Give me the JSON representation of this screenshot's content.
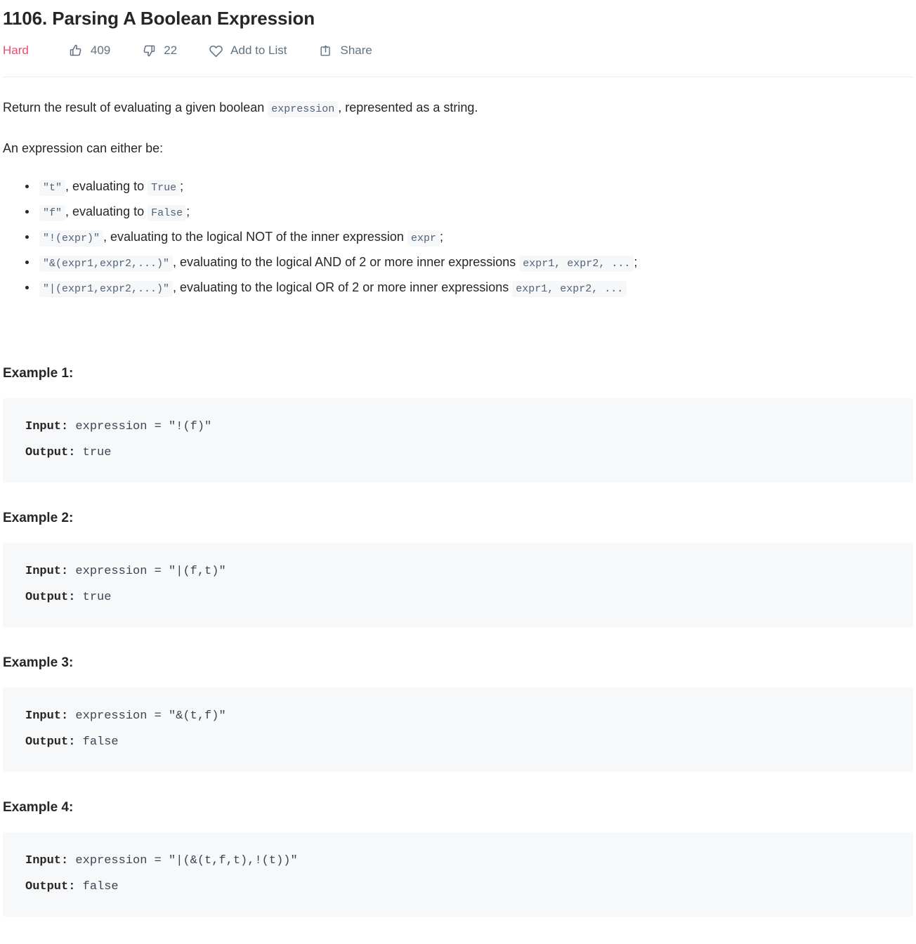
{
  "problem": {
    "title": "1106. Parsing A Boolean Expression",
    "difficulty": "Hard",
    "likes": "409",
    "dislikes": "22",
    "add_to_list_label": "Add to List",
    "share_label": "Share"
  },
  "description": {
    "intro_before": "Return the result of evaluating a given boolean ",
    "intro_code": "expression",
    "intro_after": ", represented as a string.",
    "lead": "An expression can either be:",
    "rules": [
      {
        "code": "\"t\"",
        "text_mid": ", evaluating to ",
        "code2": "True",
        "text_end": ";"
      },
      {
        "code": "\"f\"",
        "text_mid": ", evaluating to ",
        "code2": "False",
        "text_end": ";"
      },
      {
        "code": "\"!(expr)\"",
        "text_mid": ", evaluating to the logical NOT of the inner expression ",
        "code2": "expr",
        "text_end": ";"
      },
      {
        "code": "\"&(expr1,expr2,...)\"",
        "text_mid": ", evaluating to the logical AND of 2 or more inner expressions ",
        "code2": "expr1, expr2, ...",
        "text_end": ";"
      },
      {
        "code": "\"|(expr1,expr2,...)\"",
        "text_mid": ", evaluating to the logical OR of 2 or more inner expressions ",
        "code2": "expr1, expr2, ...",
        "text_end": ""
      }
    ]
  },
  "examples": [
    {
      "heading": "Example 1:",
      "input_label": "Input:",
      "input_value": " expression = \"!(f)\"",
      "output_label": "Output:",
      "output_value": " true"
    },
    {
      "heading": "Example 2:",
      "input_label": "Input:",
      "input_value": " expression = \"|(f,t)\"",
      "output_label": "Output:",
      "output_value": " true"
    },
    {
      "heading": "Example 3:",
      "input_label": "Input:",
      "input_value": " expression = \"&(t,f)\"",
      "output_label": "Output:",
      "output_value": " false"
    },
    {
      "heading": "Example 4:",
      "input_label": "Input:",
      "input_value": " expression = \"|(&(t,f,t),!(t))\"",
      "output_label": "Output:",
      "output_value": " false"
    }
  ],
  "icons": {
    "like": "thumbs-up-icon",
    "dislike": "thumbs-down-icon",
    "favorite": "heart-icon",
    "share": "share-icon"
  },
  "colors": {
    "difficulty_hard": "#ef4a6b",
    "meta_text": "#617282",
    "body_text": "#262626",
    "inline_code_bg": "#f6f7f8",
    "inline_code_text": "#50637a",
    "code_block_bg": "#f7f8fa",
    "divider": "#ebebeb"
  }
}
